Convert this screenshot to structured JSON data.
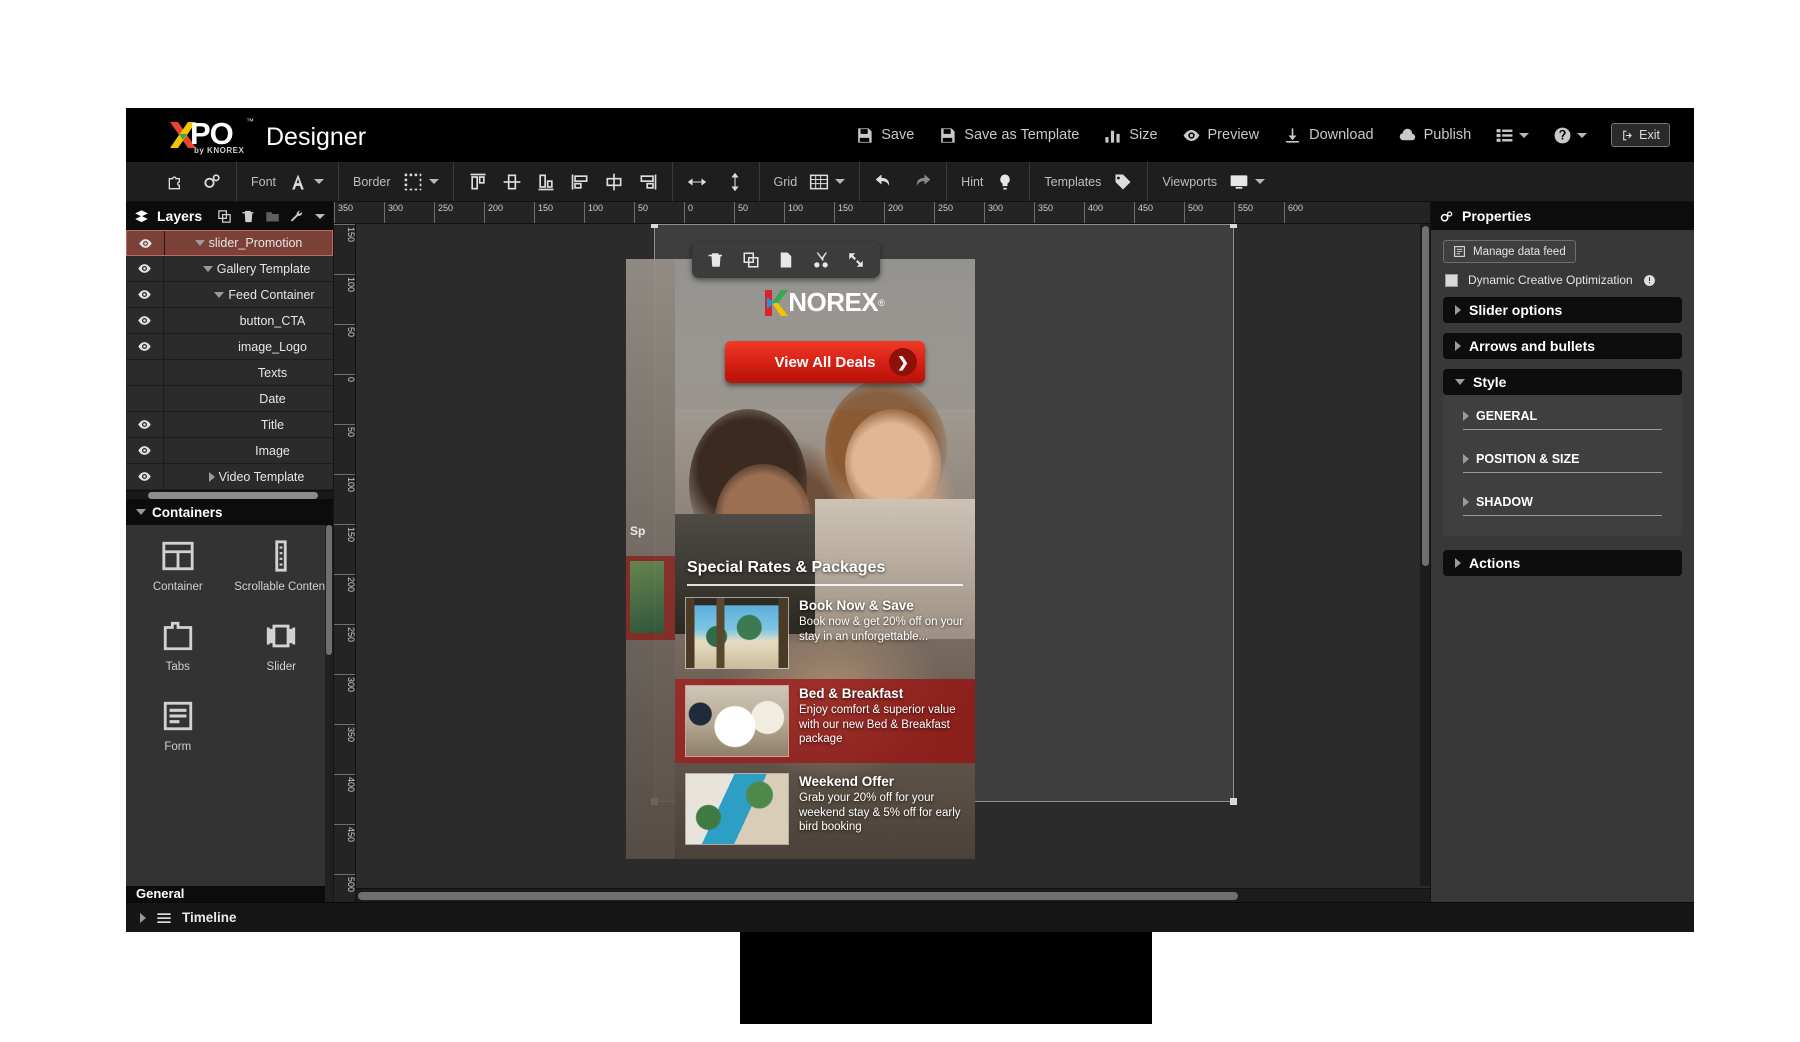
{
  "app": {
    "brand_x": "X",
    "brand_po": "PO",
    "brand_tm": "™",
    "brand_sub": "by KNOREX",
    "title": "Designer"
  },
  "topbar": {
    "buttons": [
      {
        "label": "Save",
        "icon": "save-icon"
      },
      {
        "label": "Save as Template",
        "icon": "save-template-icon"
      },
      {
        "label": "Size",
        "icon": "size-bars-icon"
      },
      {
        "label": "Preview",
        "icon": "eye-icon"
      },
      {
        "label": "Download",
        "icon": "download-icon"
      },
      {
        "label": "Publish",
        "icon": "cloud-icon"
      }
    ],
    "list_menu_icon": "list-menu-icon",
    "help_icon": "help-circle-icon",
    "exit_label": "Exit",
    "exit_icon": "exit-icon"
  },
  "toolbar": {
    "groups": [
      {
        "name": "tools",
        "items": [
          {
            "icon": "puzzle-icon",
            "label": ""
          },
          {
            "icon": "settings-gears-icon",
            "label": ""
          }
        ]
      },
      {
        "name": "font",
        "items": [
          {
            "icon": "font-a-icon",
            "label": "Font"
          }
        ]
      },
      {
        "name": "border",
        "items": [
          {
            "icon": "border-dotted-icon",
            "label": "Border"
          }
        ]
      },
      {
        "name": "align",
        "items": [
          {
            "icon": "align-top-icon",
            "label": ""
          },
          {
            "icon": "align-middle-h-icon",
            "label": ""
          },
          {
            "icon": "align-bottom-icon",
            "label": ""
          },
          {
            "icon": "align-left-icon",
            "label": ""
          },
          {
            "icon": "align-center-v-icon",
            "label": ""
          },
          {
            "icon": "align-right-icon",
            "label": ""
          }
        ]
      },
      {
        "name": "distribute",
        "items": [
          {
            "icon": "arrows-horizontal-icon",
            "label": ""
          },
          {
            "icon": "arrows-vertical-icon",
            "label": ""
          }
        ]
      },
      {
        "name": "grid",
        "items": [
          {
            "icon": "grid-icon",
            "label": "Grid"
          }
        ]
      },
      {
        "name": "history",
        "items": [
          {
            "icon": "undo-icon",
            "label": ""
          },
          {
            "icon": "redo-icon",
            "label": ""
          }
        ]
      },
      {
        "name": "hint",
        "items": [
          {
            "icon": "lightbulb-icon",
            "label": "Hint"
          }
        ]
      },
      {
        "name": "templates",
        "items": [
          {
            "icon": "tag-icon",
            "label": "Templates"
          }
        ]
      },
      {
        "name": "viewports",
        "items": [
          {
            "icon": "monitor-icon",
            "label": "Viewports"
          }
        ]
      }
    ],
    "font_label": "Font",
    "border_label": "Border",
    "grid_label": "Grid",
    "hint_label": "Hint",
    "templates_label": "Templates",
    "viewports_label": "Viewports"
  },
  "layers_panel": {
    "title": "Layers",
    "tools": [
      "duplicate-icon",
      "delete-icon",
      "folder-icon",
      "wrench-icon"
    ],
    "items": [
      {
        "label": "slider_Promotion",
        "indent": 0,
        "expanded": true,
        "visible": true,
        "selected": true
      },
      {
        "label": "Gallery Template",
        "indent": 1,
        "expanded": true,
        "visible": true,
        "selected": false
      },
      {
        "label": "Feed Container",
        "indent": 2,
        "expanded": true,
        "visible": true,
        "selected": false
      },
      {
        "label": "button_CTA",
        "indent": 3,
        "expanded": null,
        "visible": true,
        "selected": false
      },
      {
        "label": "image_Logo",
        "indent": 3,
        "expanded": null,
        "visible": true,
        "selected": false
      },
      {
        "label": "Texts",
        "indent": 3,
        "expanded": null,
        "visible": false,
        "selected": false
      },
      {
        "label": "Date",
        "indent": 3,
        "expanded": null,
        "visible": false,
        "selected": false
      },
      {
        "label": "Title",
        "indent": 3,
        "expanded": null,
        "visible": true,
        "selected": false
      },
      {
        "label": "Image",
        "indent": 3,
        "expanded": null,
        "visible": true,
        "selected": false
      },
      {
        "label": "Video Template",
        "indent": 1,
        "expanded": false,
        "visible": true,
        "selected": false
      }
    ]
  },
  "containers_panel": {
    "title": "Containers",
    "items": [
      {
        "label": "Container",
        "icon": "container-icon"
      },
      {
        "label": "Scrollable Content",
        "icon": "scrollable-content-icon"
      },
      {
        "label": "Tabs",
        "icon": "tabs-icon"
      },
      {
        "label": "Slider",
        "icon": "slider-icon"
      },
      {
        "label": "Form",
        "icon": "form-icon"
      }
    ],
    "next_section": "General"
  },
  "canvas": {
    "ruler_h_ticks": [
      "350",
      "300",
      "250",
      "200",
      "150",
      "100",
      "50",
      "0",
      "50",
      "100",
      "150",
      "200",
      "250",
      "300",
      "350",
      "400",
      "450",
      "500",
      "550",
      "600"
    ],
    "ruler_v_ticks": [
      "150",
      "100",
      "50",
      "0",
      "50",
      "100",
      "150",
      "200",
      "250",
      "300",
      "350",
      "400",
      "450",
      "500"
    ],
    "float_tools": [
      "delete-icon",
      "duplicate-icon",
      "copy-icon",
      "cut-scissors-icon",
      "expand-icon"
    ]
  },
  "ad": {
    "logo_k": "K",
    "logo_text": "NOREX",
    "logo_reg": "®",
    "cta_label": "View All Deals",
    "cta_arrow": "chevron-right-icon",
    "section_title": "Special Rates & Packages",
    "deals": [
      {
        "title": "Book Now & Save",
        "desc": "Book now & get 20% off on your stay in an unforgettable...",
        "thumb": "beach-palms-photo"
      },
      {
        "title": "Bed & Breakfast",
        "desc": "Enjoy comfort & superior value with our new Bed & Breakfast package",
        "thumb": "breakfast-table-photo"
      },
      {
        "title": "Weekend Offer",
        "desc": "Grab your 20% off for your weekend stay & 5% off for early bird booking",
        "thumb": "pool-resort-photo"
      }
    ]
  },
  "properties_panel": {
    "title": "Properties",
    "manage_feed_label": "Manage data feed",
    "dco_label": "Dynamic Creative Optimization",
    "dco_checked": false,
    "accordions": [
      {
        "label": "Slider options",
        "expanded": false
      },
      {
        "label": "Arrows and bullets",
        "expanded": false
      },
      {
        "label": "Style",
        "expanded": true
      },
      {
        "label": "Actions",
        "expanded": false
      }
    ],
    "style_sections": [
      {
        "label": "GENERAL"
      },
      {
        "label": "POSITION & SIZE"
      },
      {
        "label": "SHADOW"
      }
    ]
  },
  "timeline": {
    "label": "Timeline",
    "expanded": false
  },
  "colors": {
    "accent_red": "#d41f14",
    "selected_layer": "#7b4038",
    "panel_dark": "#0d0d0d",
    "app_bg": "#2b2b2b"
  }
}
